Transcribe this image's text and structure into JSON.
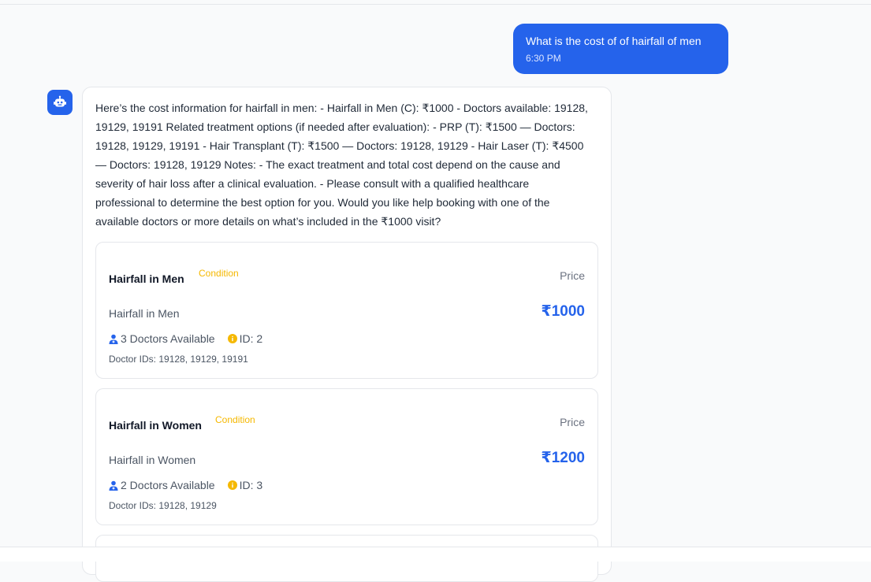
{
  "user_message": {
    "text": "What is the cost of of hairfall of men",
    "time": "6:30 PM"
  },
  "bot_message": {
    "avatar_icon": "robot-icon",
    "text": "Here’s the cost information for hairfall in men: - Hairfall in Men (C): ₹1000 - Doctors available: 19128, 19129, 19191 Related treatment options (if needed after evaluation): - PRP (T): ₹1500 — Doctors: 19128, 19129, 19191 - Hair Transplant (T): ₹1500 — Doctors: 19128, 19129 - Hair Laser (T): ₹4500 — Doctors: 19128, 19129 Notes: - The exact treatment and total cost depend on the cause and severity of hair loss after a clinical evaluation. - Please consult with a qualified healthcare professional to determine the best option for you. Would you like help booking with one of the available doctors or more details on what’s included in the ₹1000 visit?"
  },
  "cards": [
    {
      "title": "Hairfall in Men",
      "tag": "Condition",
      "price_label": "Price",
      "subtitle": "Hairfall in Men",
      "price": "₹1000",
      "doctors_available": "3 Doctors Available",
      "id_text": "ID: 2",
      "doctor_ids": "Doctor IDs: 19128, 19129, 19191"
    },
    {
      "title": "Hairfall in Women",
      "tag": "Condition",
      "price_label": "Price",
      "subtitle": "Hairfall in Women",
      "price": "₹1200",
      "doctors_available": "2 Doctors Available",
      "id_text": "ID: 3",
      "doctor_ids": "Doctor IDs: 19128, 19129"
    }
  ],
  "colors": {
    "accent": "#2563eb",
    "tag": "#f5b800",
    "info_icon": "#f5b800"
  }
}
